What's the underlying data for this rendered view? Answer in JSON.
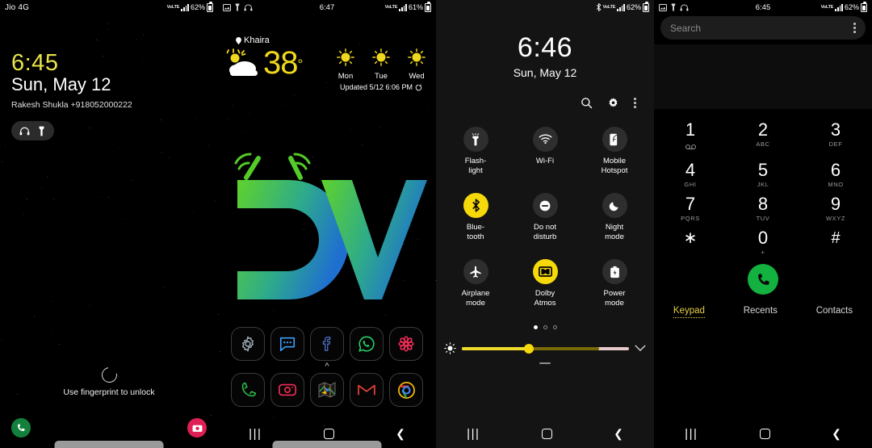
{
  "lockscreen": {
    "status": {
      "carrier": "Jio 4G",
      "battery": "62%",
      "network": "VoLTE"
    },
    "clock": "6:45",
    "date": "Sun, May 12",
    "owner_info": "Rakesh Shukla +918052000222",
    "shortcut_pill": [
      "headphones-icon",
      "flashlight-icon"
    ],
    "fingerprint_hint": "Use fingerprint to unlock",
    "bottom_left_icon": "phone-icon",
    "bottom_right_icon": "camera-icon",
    "colors": {
      "clock": "#e9e34a",
      "phone_btn": "#13803b",
      "camera_btn": "#e01f55"
    }
  },
  "homescreen": {
    "status": {
      "time": "6:47",
      "battery": "61%",
      "notif_icons": [
        "screenshot-icon",
        "flashlight-icon",
        "headphones-icon"
      ]
    },
    "weather": {
      "city": "Khaira",
      "temperature": "38",
      "degree_symbol": "°",
      "condition_icon": "partly-cloudy-icon",
      "forecast": [
        {
          "day": "Mon",
          "icon": "sunny-icon"
        },
        {
          "day": "Tue",
          "icon": "sunny-icon"
        },
        {
          "day": "Wed",
          "icon": "sunny-icon"
        }
      ],
      "updated": "Updated 5/12 6:06 PM",
      "temp_color": "#f0d81e"
    },
    "wallpaper_logo": {
      "text": "DV",
      "gradient_from": "#5fd22b",
      "gradient_to": "#1f6fd0"
    },
    "dock_row1": [
      {
        "name": "settings",
        "icon": "gear-icon",
        "color": "#9aa3b0"
      },
      {
        "name": "messages",
        "icon": "chat-bubble-icon",
        "color": "#3b9ef5"
      },
      {
        "name": "facebook",
        "icon": "facebook-icon",
        "color": "#4267b2"
      },
      {
        "name": "whatsapp",
        "icon": "whatsapp-icon",
        "color": "#25d366"
      },
      {
        "name": "gallery",
        "icon": "flower-icon",
        "color": "#ef2d56"
      }
    ],
    "dock_row2": [
      {
        "name": "phone",
        "icon": "phone-icon",
        "color": "#2bb64a"
      },
      {
        "name": "camera",
        "icon": "camera-icon",
        "color": "#ef2d56"
      },
      {
        "name": "maps",
        "icon": "maps-icon",
        "color": "#34a853"
      },
      {
        "name": "gmail",
        "icon": "gmail-icon",
        "color": "#ea4335"
      },
      {
        "name": "chrome",
        "icon": "chrome-icon",
        "color": "#4285f4"
      }
    ],
    "app_drawer_arrow": "chevron-up-icon"
  },
  "quicksettings": {
    "status": {
      "battery": "62%",
      "icons": [
        "bluetooth-icon",
        "volte-icon",
        "signal-icon"
      ]
    },
    "clock": "6:46",
    "date": "Sun, May 12",
    "tools": [
      "search-icon",
      "gear-icon",
      "overflow-menu-icon"
    ],
    "toggles": [
      {
        "label": "Flash-\nlight",
        "icon": "flashlight-icon",
        "active": false
      },
      {
        "label": "Wi-Fi",
        "icon": "wifi-icon",
        "active": false
      },
      {
        "label": "Mobile\nHotspot",
        "icon": "hotspot-icon",
        "active": false
      },
      {
        "label": "Blue-\ntooth",
        "icon": "bluetooth-icon",
        "active": true
      },
      {
        "label": "Do not\ndisturb",
        "icon": "dnd-icon",
        "active": false
      },
      {
        "label": "Night\nmode",
        "icon": "moon-icon",
        "active": false
      },
      {
        "label": "Airplane\nmode",
        "icon": "airplane-icon",
        "active": false
      },
      {
        "label": "Dolby\nAtmos",
        "icon": "dolby-icon",
        "active": true
      },
      {
        "label": "Power\nmode",
        "icon": "battery-saver-icon",
        "active": false
      }
    ],
    "page_dots": {
      "count": 3,
      "active_index": 0
    },
    "brightness": {
      "value_percent": 40,
      "icon": "brightness-icon",
      "expand_icon": "chevron-down-icon"
    },
    "accent_color": "#f5d90a"
  },
  "dialer": {
    "status": {
      "time": "6:45",
      "battery": "62%",
      "notif_icons": [
        "screenshot-icon",
        "flashlight-icon",
        "headphones-icon"
      ]
    },
    "search": {
      "placeholder": "Search",
      "menu_icon": "overflow-menu-icon"
    },
    "keys": [
      {
        "num": "1",
        "sub": "voicemail-icon"
      },
      {
        "num": "2",
        "sub": "ABC"
      },
      {
        "num": "3",
        "sub": "DEF"
      },
      {
        "num": "4",
        "sub": "GHI"
      },
      {
        "num": "5",
        "sub": "JKL"
      },
      {
        "num": "6",
        "sub": "MNO"
      },
      {
        "num": "7",
        "sub": "PQRS"
      },
      {
        "num": "8",
        "sub": "TUV"
      },
      {
        "num": "9",
        "sub": "WXYZ"
      },
      {
        "num": "∗",
        "sub": ""
      },
      {
        "num": "0",
        "sub": "+"
      },
      {
        "num": "#",
        "sub": ""
      }
    ],
    "call_button": {
      "icon": "phone-icon",
      "color": "#13b13f"
    },
    "tabs": [
      {
        "label": "Keypad",
        "active": true
      },
      {
        "label": "Recents",
        "active": false
      },
      {
        "label": "Contacts",
        "active": false
      }
    ],
    "active_tab_color": "#e6cf45"
  },
  "navbar": {
    "recents_icon": "recents-icon",
    "home_icon": "home-icon",
    "back_icon": "back-icon"
  }
}
